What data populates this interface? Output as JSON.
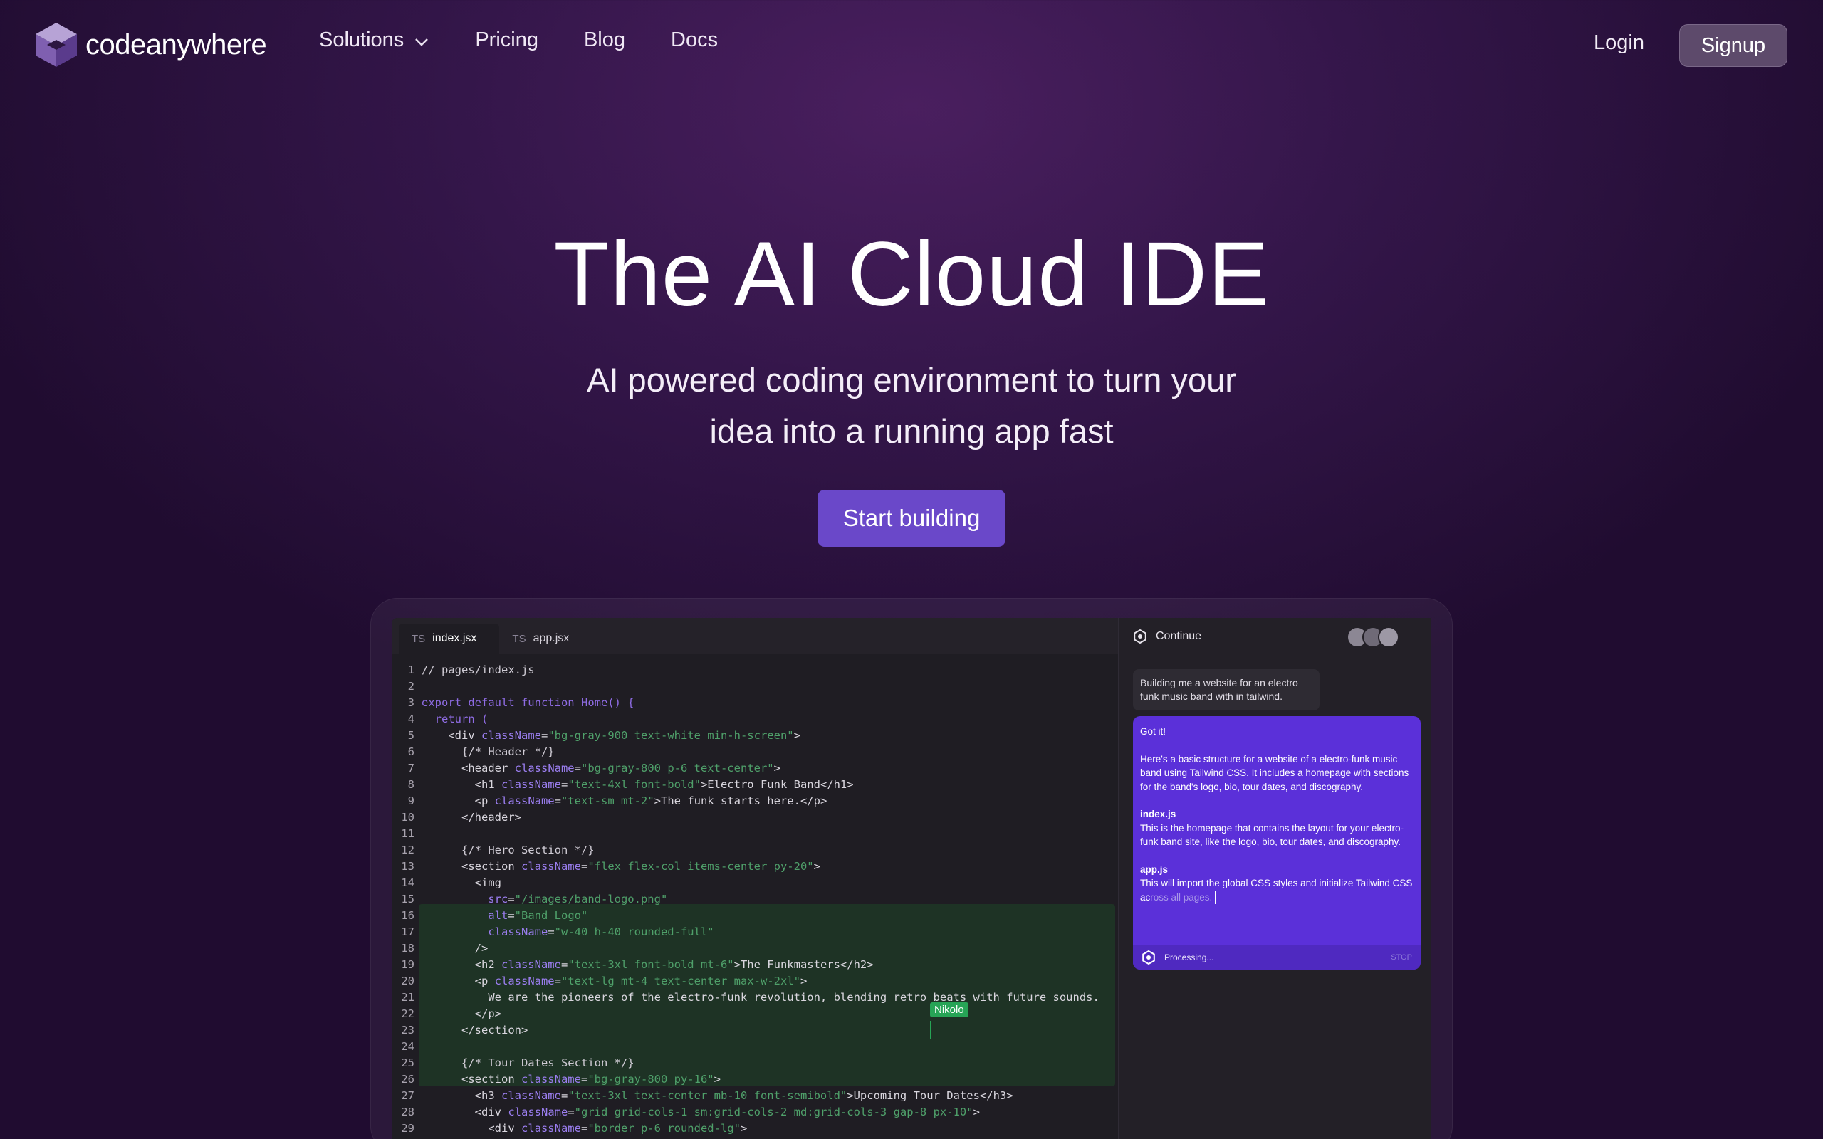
{
  "brand": {
    "name": "codeanywhere"
  },
  "nav": {
    "links": [
      "Solutions",
      "Pricing",
      "Blog",
      "Docs"
    ],
    "login": "Login",
    "signup": "Signup"
  },
  "hero": {
    "title": "The AI Cloud IDE",
    "subtitle_line1": "AI powered coding environment to turn your",
    "subtitle_line2": "idea into a running app fast",
    "cta": "Start building"
  },
  "editor": {
    "tabs": [
      {
        "lang": "TS",
        "name": "index.jsx",
        "active": true
      },
      {
        "lang": "TS",
        "name": "app.jsx",
        "active": false
      }
    ],
    "collaborator": "Nikolo",
    "lines": [
      "// pages/index.js",
      "",
      "export default function Home() {",
      "  return (",
      "    <div className=\"bg-gray-900 text-white min-h-screen\">",
      "      {/* Header */}",
      "      <header className=\"bg-gray-800 p-6 text-center\">",
      "        <h1 className=\"text-4xl font-bold\">Electro Funk Band</h1>",
      "        <p className=\"text-sm mt-2\">The funk starts here.</p>",
      "      </header>",
      "",
      "      {/* Hero Section */}",
      "      <section className=\"flex flex-col items-center py-20\">",
      "        <img",
      "          src=\"/images/band-logo.png\"",
      "          alt=\"Band Logo\"",
      "          className=\"w-40 h-40 rounded-full\"",
      "        />",
      "        <h2 className=\"text-3xl font-bold mt-6\">The Funkmasters</h2>",
      "        <p className=\"text-lg mt-4 text-center max-w-2xl\">",
      "          We are the pioneers of the electro-funk revolution, blending retro beats with future sounds.",
      "        </p>",
      "      </section>",
      "",
      "      {/* Tour Dates Section */}",
      "      <section className=\"bg-gray-800 py-16\">",
      "        <h3 className=\"text-3xl text-center mb-10 font-semibold\">Upcoming Tour Dates</h3>",
      "        <div className=\"grid grid-cols-1 sm:grid-cols-2 md:grid-cols-3 gap-8 px-10\">",
      "          <div className=\"border p-6 rounded-lg\">"
    ]
  },
  "chat": {
    "title": "Continue",
    "user_message": "Building me a website for an electro funk music band with in tailwind.",
    "ai_intro": "Got it!",
    "ai_paragraph": "Here's a basic structure for a website of a electro-funk music band using Tailwind CSS. It includes a homepage with sections for the band's logo, bio, tour dates, and discography.",
    "file1_name": "index.js",
    "file1_desc": "This is the homepage that contains the layout for your electro-funk band site, like the logo, bio, tour dates, and discography.",
    "file2_name": "app.js",
    "file2_desc_start": "This will import the global CSS styles and initialize Tailwind CSS ac",
    "file2_desc_fade": "ross all pages.",
    "status": "Processing...",
    "stop": "STOP"
  }
}
